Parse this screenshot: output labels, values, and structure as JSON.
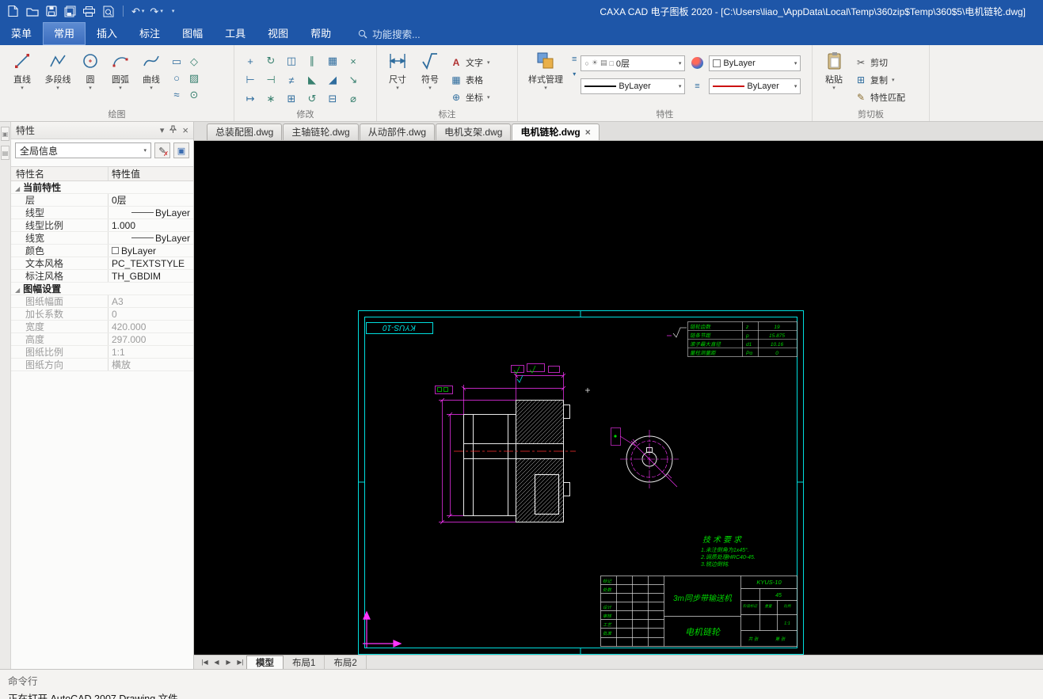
{
  "title_bar": {
    "title": "CAXA CAD 电子图板 2020 - [C:\\Users\\liao_\\AppData\\Local\\Temp\\360zip$Temp\\360$5\\电机链轮.dwg]"
  },
  "menu_bar": {
    "items": [
      "菜单",
      "常用",
      "插入",
      "标注",
      "图幅",
      "工具",
      "视图",
      "帮助"
    ],
    "search_placeholder": "功能搜索..."
  },
  "icons": {
    "quick_access": [
      "new",
      "open",
      "save",
      "save-all",
      "print",
      "print-preview",
      "undo",
      "redo",
      "customize"
    ],
    "modify_tools": [
      "move",
      "rotate",
      "mirror",
      "offset",
      "array",
      "erase",
      "extend",
      "trim",
      "break",
      "chamfer",
      "fillet",
      "scale",
      "stretch",
      "explode",
      "copy",
      "rotate-ccw",
      "mirror-v",
      "diameter"
    ]
  },
  "ribbon": {
    "draw": {
      "label": "绘图",
      "tools": [
        "直线",
        "多段线",
        "圆",
        "圆弧",
        "曲线"
      ]
    },
    "modify": {
      "label": "修改"
    },
    "annotate": {
      "label": "标注",
      "dim": "尺寸",
      "symbol": "符号",
      "text": "文字",
      "table": "表格",
      "coord": "坐标"
    },
    "properties": {
      "label": "特性",
      "style_manager": "样式管理",
      "layer": "0层",
      "color": "ByLayer",
      "linetype": "ByLayer",
      "lineweight": "ByLayer"
    },
    "clipboard": {
      "label": "剪切板",
      "paste": "粘贴",
      "cut": "剪切",
      "copy": "复制",
      "match": "特性匹配"
    }
  },
  "properties_panel": {
    "title": "特性",
    "scope": "全局信息",
    "col_name": "特性名",
    "col_value": "特性值",
    "group1": "当前特性",
    "rows1": [
      {
        "name": "层",
        "value": "0层"
      },
      {
        "name": "线型",
        "value": "ByLayer"
      },
      {
        "name": "线型比例",
        "value": "1.000"
      },
      {
        "name": "线宽",
        "value": "ByLayer"
      },
      {
        "name": "颜色",
        "value": "ByLayer"
      },
      {
        "name": "文本风格",
        "value": "PC_TEXTSTYLE"
      },
      {
        "name": "标注风格",
        "value": "TH_GBDIM"
      }
    ],
    "group2": "图幅设置",
    "rows2": [
      {
        "name": "图纸幅面",
        "value": "A3"
      },
      {
        "name": "加长系数",
        "value": "0"
      },
      {
        "name": "宽度",
        "value": "420.000"
      },
      {
        "name": "高度",
        "value": "297.000"
      },
      {
        "name": "图纸比例",
        "value": "1:1"
      },
      {
        "name": "图纸方向",
        "value": "横放"
      }
    ]
  },
  "document_tabs": [
    "总装配图.dwg",
    "主轴链轮.dwg",
    "从动部件.dwg",
    "电机支架.dwg",
    "电机链轮.dwg"
  ],
  "drawing": {
    "sheet_label": "KYUS-10",
    "param_table": {
      "rows": [
        {
          "name": "链轮齿数",
          "sym": "z",
          "val": "19"
        },
        {
          "name": "链条节距",
          "sym": "p",
          "val": "15.875"
        },
        {
          "name": "滚子最大直径",
          "sym": "d1",
          "val": "10.16"
        },
        {
          "name": "量柱测量距",
          "sym": "Pα",
          "val": "0"
        }
      ]
    },
    "tech_req": {
      "title": "技术要求",
      "lines": [
        "1.未注倒角为1x45°.",
        "2.调质处理HRC40-45.",
        "3.锐边倒钝."
      ]
    },
    "title_block": {
      "project": "3m同步带输送机",
      "part": "电机链轮",
      "drawing_no": "KYUS-10",
      "material": "45",
      "labels": [
        "标记",
        "处数",
        "设计",
        "审核",
        "工艺",
        "批准"
      ],
      "stage": "阶段标记",
      "weight": "重量",
      "scale": "比例",
      "scale_val": "1:1",
      "sheets": "共 张",
      "sheet_no": "第 张"
    }
  },
  "layout_tabs": [
    "模型",
    "布局1",
    "布局2"
  ],
  "command_panel": {
    "label": "命令行",
    "message": "正在打开 AutoCAD 2007 Drawing 文件"
  }
}
